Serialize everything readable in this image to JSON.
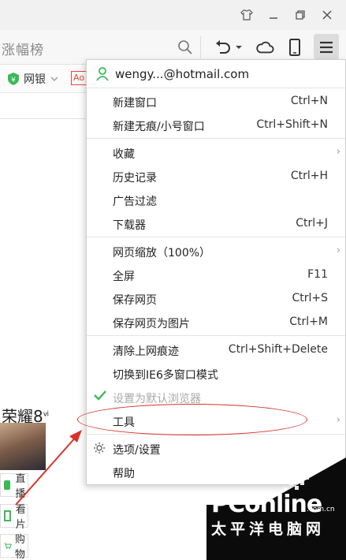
{
  "window": {
    "buttons": [
      "skin-icon",
      "minimize-icon",
      "restore-icon",
      "close-icon"
    ]
  },
  "toolbar": {
    "search_partial": "涨幅榜",
    "icons": [
      "search-icon",
      "undo-icon",
      "dropdown-caret-icon",
      "cloud-icon",
      "phone-icon",
      "menu-icon"
    ]
  },
  "bookmarks": {
    "bank_label": "网银",
    "ad_badge": "Ao"
  },
  "page": {
    "phone_ad": "荣耀8",
    "phone_ad_sup": "ⅵ",
    "side_buttons": [
      {
        "label": "直播"
      },
      {
        "label": "看片"
      },
      {
        "label": "购物"
      }
    ]
  },
  "menu": {
    "account": "wengy...@hotmail.com",
    "items": [
      {
        "label": "新建窗口",
        "shortcut": "Ctrl+N"
      },
      {
        "label": "新建无痕/小号窗口",
        "shortcut": "Ctrl+Shift+N"
      },
      {
        "label": "收藏",
        "shortcut": ""
      },
      {
        "label": "历史记录",
        "shortcut": "Ctrl+H"
      },
      {
        "label": "广告过滤",
        "shortcut": ""
      },
      {
        "label": "下载器",
        "shortcut": "Ctrl+J"
      },
      {
        "label": "网页缩放（100%）",
        "shortcut": ""
      },
      {
        "label": "全屏",
        "shortcut": "F11"
      },
      {
        "label": "保存网页",
        "shortcut": "Ctrl+S"
      },
      {
        "label": "保存网页为图片",
        "shortcut": "Ctrl+M"
      },
      {
        "label": "清除上网痕迹",
        "shortcut": "Ctrl+Shift+Delete"
      },
      {
        "label": "切换到IE6多窗口模式",
        "shortcut": ""
      },
      {
        "label": "设置为默认浏览器",
        "shortcut": ""
      },
      {
        "label": "工具",
        "shortcut": ""
      },
      {
        "label": "选项/设置",
        "shortcut": ""
      },
      {
        "label": "帮助",
        "shortcut": ""
      }
    ]
  },
  "watermark": {
    "brand": "PConline",
    "domain": ".com.cn",
    "cn": "太平洋电脑网"
  },
  "colors": {
    "accent_green": "#3cb85a",
    "annotation_red": "#d9322b",
    "menu_bg": "#ffffff"
  }
}
